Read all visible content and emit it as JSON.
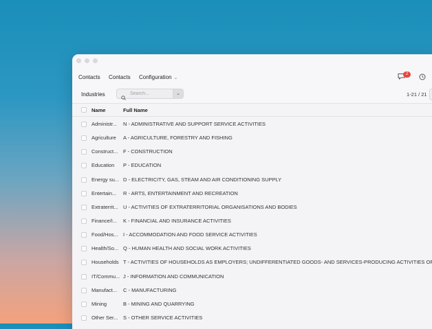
{
  "navbar": {
    "app_label": "Contacts",
    "menu_contacts": "Contacts",
    "menu_configuration": "Configuration",
    "chevron": "⌄",
    "messages_badge": "2",
    "icons": {
      "messages": "chat-icon",
      "activity": "clock-icon"
    }
  },
  "control_panel": {
    "title": "Industries",
    "search_placeholder": "Search...",
    "toggle_glyph": "⌄",
    "pager": "1-21 / 21"
  },
  "table": {
    "headers": {
      "name": "Name",
      "full_name": "Full Name"
    },
    "rows": [
      {
        "name": "Administr...",
        "full_name": "N - ADMINISTRATIVE AND SUPPORT SERVICE ACTIVITIES"
      },
      {
        "name": "Agriculture",
        "full_name": "A - AGRICULTURE, FORESTRY AND FISHING"
      },
      {
        "name": "Construct...",
        "full_name": "F - CONSTRUCTION"
      },
      {
        "name": "Education",
        "full_name": "P - EDUCATION"
      },
      {
        "name": "Energy su...",
        "full_name": "D - ELECTRICITY, GAS, STEAM AND AIR CONDITIONING SUPPLY"
      },
      {
        "name": "Entertain...",
        "full_name": "R - ARTS, ENTERTAINMENT AND RECREATION"
      },
      {
        "name": "Extraterrit...",
        "full_name": "U - ACTIVITIES OF EXTRATERRITORIAL ORGANISATIONS AND BODIES"
      },
      {
        "name": "Finance/I...",
        "full_name": "K - FINANCIAL AND INSURANCE ACTIVITIES"
      },
      {
        "name": "Food/Hos...",
        "full_name": "I - ACCOMMODATION AND FOOD SERVICE ACTIVITIES"
      },
      {
        "name": "Health/So...",
        "full_name": "Q - HUMAN HEALTH AND SOCIAL WORK ACTIVITIES"
      },
      {
        "name": "Households",
        "full_name": "T - ACTIVITIES OF HOUSEHOLDS AS EMPLOYERS; UNDIFFERENTIATED GOODS- AND SERVICES-PRODUCING ACTIVITIES OF HOU"
      },
      {
        "name": "IT/Commu...",
        "full_name": "J - INFORMATION AND COMMUNICATION"
      },
      {
        "name": "Manufact...",
        "full_name": "C - MANUFACTURING"
      },
      {
        "name": "Mining",
        "full_name": "B - MINING AND QUARRYING"
      },
      {
        "name": "Other Ser...",
        "full_name": "S - OTHER SERVICE ACTIVITIES"
      }
    ]
  }
}
